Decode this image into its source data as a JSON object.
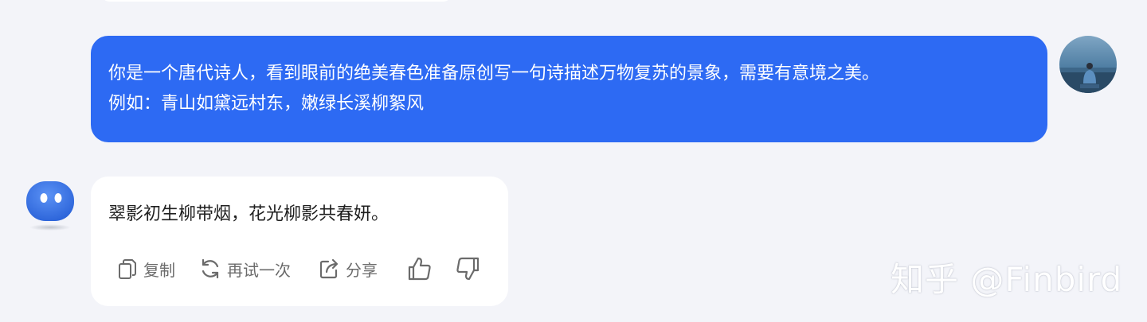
{
  "user_message": {
    "lines": [
      "你是一个唐代诗人，看到眼前的绝美春色准备原创写一句诗描述万物复苏的景象，需要有意境之美。",
      "例如：青山如黛远村东，嫩绿长溪柳絮风"
    ],
    "bubble_color": "#2d6af3"
  },
  "bot_message": {
    "text": "翠影初生柳带烟，花光柳影共春妍。"
  },
  "actions": [
    {
      "label": "复制",
      "icon": "copy-icon"
    },
    {
      "label": "再试一次",
      "icon": "refresh-icon"
    },
    {
      "label": "分享",
      "icon": "share-icon"
    },
    {
      "label": "",
      "icon": "thumbs-up-icon"
    },
    {
      "label": "",
      "icon": "thumbs-down-icon"
    }
  ],
  "watermark": "知乎 @Finbird",
  "colors": {
    "background": "#f3f4f9",
    "bot_avatar": "#3b73e6",
    "action_gray": "#6b6b6b"
  }
}
